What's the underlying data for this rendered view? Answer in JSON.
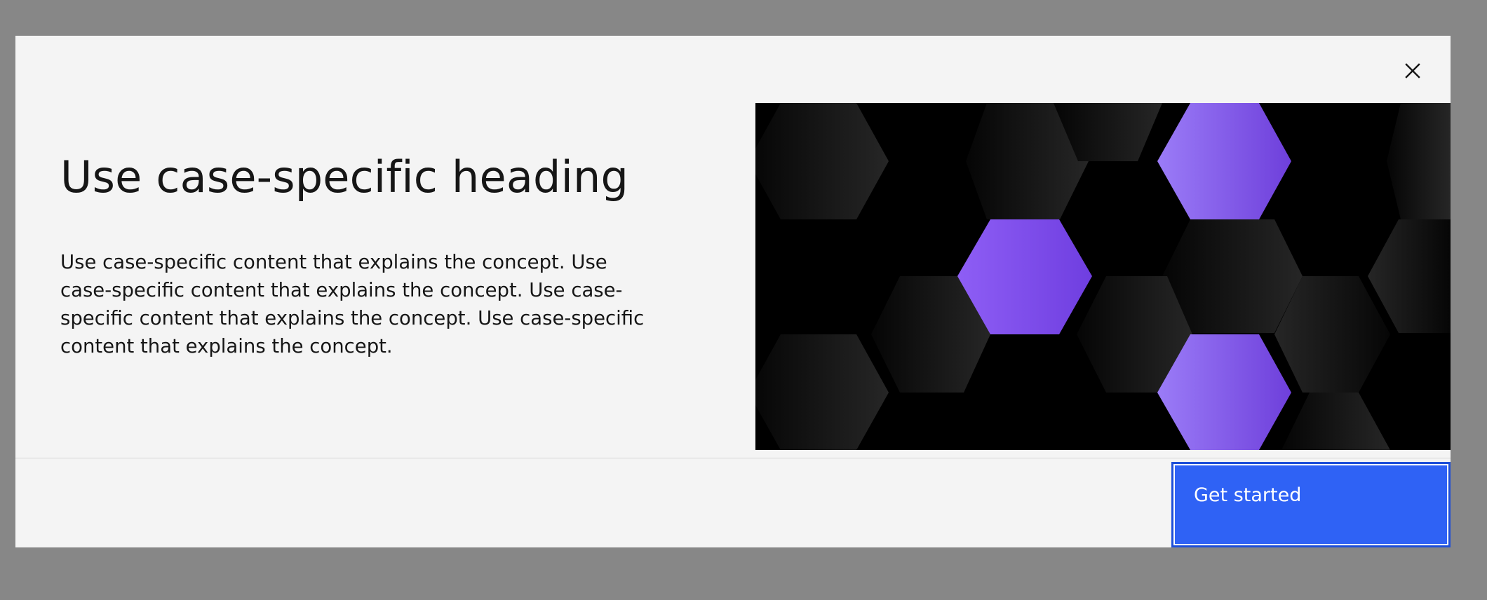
{
  "modal": {
    "heading": "Use case-specific heading",
    "body": "Use case-specific content that explains the concept. Use case-specific content that explains the concept. Use case-specific content that explains the concept. Use case-specific content that explains the concept.",
    "close_icon": "close-icon",
    "primary_button": "Get started"
  },
  "colors": {
    "overlay": "#878787",
    "modal_bg": "#f4f4f4",
    "text": "#161616",
    "primary": "#2f62f5",
    "hex_purple_start": "#9b7cf7",
    "hex_purple_end": "#6e3fdb"
  }
}
